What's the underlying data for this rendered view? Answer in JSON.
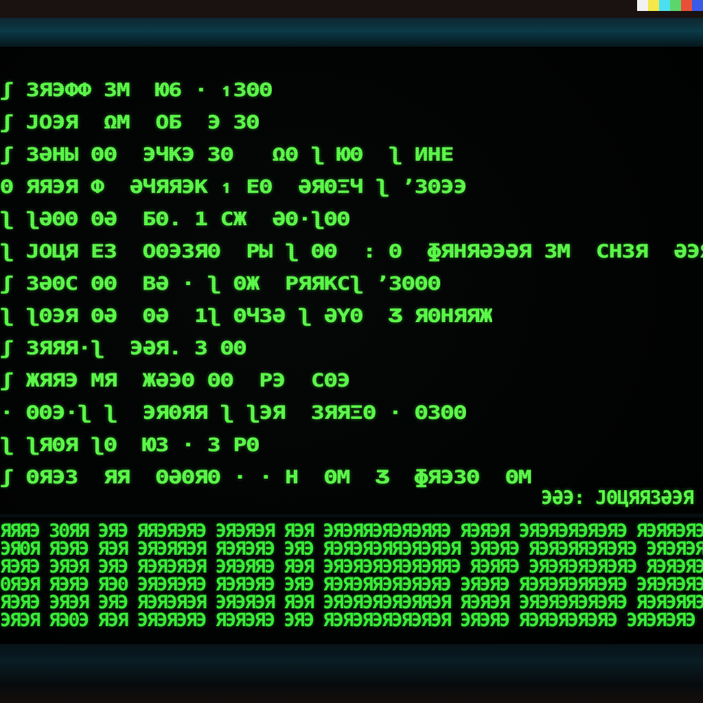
{
  "colors": {
    "text": "#3cf03a",
    "text_bright": "#5dff4a",
    "background": "#000000"
  },
  "terminal": {
    "lines": [
      "ʃ ЗЯЭФФ ЗМ  Ю6 · ↿ЗΘΘ",
      "ʃ ЈОЭЯ  ΩМ  ОБ  Э ЗΘ",
      "ʃ ЗӘНЫ ΘΘ  ЭЧКЭ ЗΘ   ΩΘ ʅ ЮΘ  ʅ ИНЕ",
      "Θ ЯЯЭЯ Ф  ӘЧЯЯЭК ↿ ЕΘ  ӘЯΘΞЧ ʅ ʼЗΘЭЭ",
      "ʅ ʅӘΘΘ ΘӘ  БΘ. 1 СЖ  ӘΘ·ʅΘΘ",
      "ʅ ЈОЦЯ ЕЗ  ОΘЭЗЯΘ  ΡЫ ʅ ΘΘ  : Θ  ɸЯНЯӘЭӘЯ ЗΜ  СНЗЯ  ӘЭЯЕЗΘΘЯ",
      "ʃ ЗӘΘС ΘΘ  ВӘ · ʅ ΘЖ  ΡЯЯКСʅ ʼЗΘΘΘ",
      "ʅ ʅΘЭЯ ΘӘ  ΘӘ  1ʅ ΘЧЗӘ ʅ ӘҮΘ  Ӡ ЯΘНЯЯЖ",
      "ʃ ЗЯЯЯ·ʅ  ЭӘЯ. З ΘΘ",
      "ʃ ЖЯЯЭ ΜЯ  ЖӘЭΘ ΘΘ  ΡЭ  СΘЭ",
      "· ΘΘЭ·ʅ ʅ  ЭЯΘЯЯ ʅ ʅЭЯ  ЗЯЯΞΘ · ΘЗΘΘ",
      "ʅ ʅЯΘЯ ʅΘ  ЮЗ · З ΡΘ",
      "ʃ ΘЯЭЗ  ЯЯ  ΘӘΘЯΘ · · Н  ΘΜ  Ӡ  ɸЯЭЗΘ  ΘΜ"
    ],
    "status": "ЭӘЭ: ЈΘЦЯЯЗӘЭЯ"
  },
  "grid": {
    "rows": [
      "ЯЯЯЭ ЗΘЯЯ ЭЯЭ ЯЯЭЯЭЯЭ ЭЯЭЯЭЯ ЯЭЯ ЭЯЭЯЯЭЯЭЯЭЯЯЭ ЯЭЯЭЯ ЭЯЭЯЭЯЭЯЭЯЭ ЯЭЯЯЭЯЭ",
      "ЭЯΘЯ ЯЭЯЭ ЯЭЯ ЭЯЭЯЯЭЯ ЯЭЯЭЯЭ ЭЯЭ ЯЭЯЭЯЭЯЯЭЯЭЯЭЯ ЭЯЭЯЭ ЯЭЯЭЯЯЭЯЭЯЭ ЭЯЭЯЭЯЭ",
      "ЯЭЯЭ ЭЯЭЯ ЭЯЭ ЯЭЯЭЯЭЯ ЭЯЭЯЯЭ ЯЭЯ ЭЯЭЯЭЯЭЯЭЯЭЯЯЭ ЯЭЯЯЭ ЭЯЭЯЭЯЭЯЭЯЭ ЯЭЯЭЯЭЯ",
      "ΘЯЭЯ ЯЭЯЭ ЯЭΘ ЭЯЭЯЭЯЭ ЯЭЯЭЯЭ ЭЯЭ ЯЭЯЭЯЯЭЯЭЯЭЯЭ ЭЯЭЯЭ ЯЭЯЭЯЭЯЯЭЯЭ ЭЯЭЯЭЯЭ",
      "ЯЭЯЭ ЭЯЭЯ ЭЯЭ ЯЭЯЭЯЭЯ ЭЯЭЯЭЯ ЯЭЯ ЭЯЭЯЭЯЭЯЭЯЯЭЯ ЯЭЯЭЯ ЭЯЭЯЭЯЭЯЭЯЭ ЯЭЯЭЯЯЭ",
      "ЭЯЭЯ ЯЭΘЭ ЯЭЯ ЭЯЭЯЭЯЭ ЯЭЯЭЯЭ ЭЯЭ ЯЭЯЭЯЭЯЭЯЭЯЭЯ ЭЯЭЯЭ ЯЭЯЭЯЭЯЭЯЭ ЭЯЭЯЭЯЭ"
    ]
  },
  "strip_colors": [
    "#f2f2f2",
    "#f5e84a",
    "#4be0f0",
    "#5bd66a",
    "#e8503a",
    "#3a5ae8"
  ]
}
